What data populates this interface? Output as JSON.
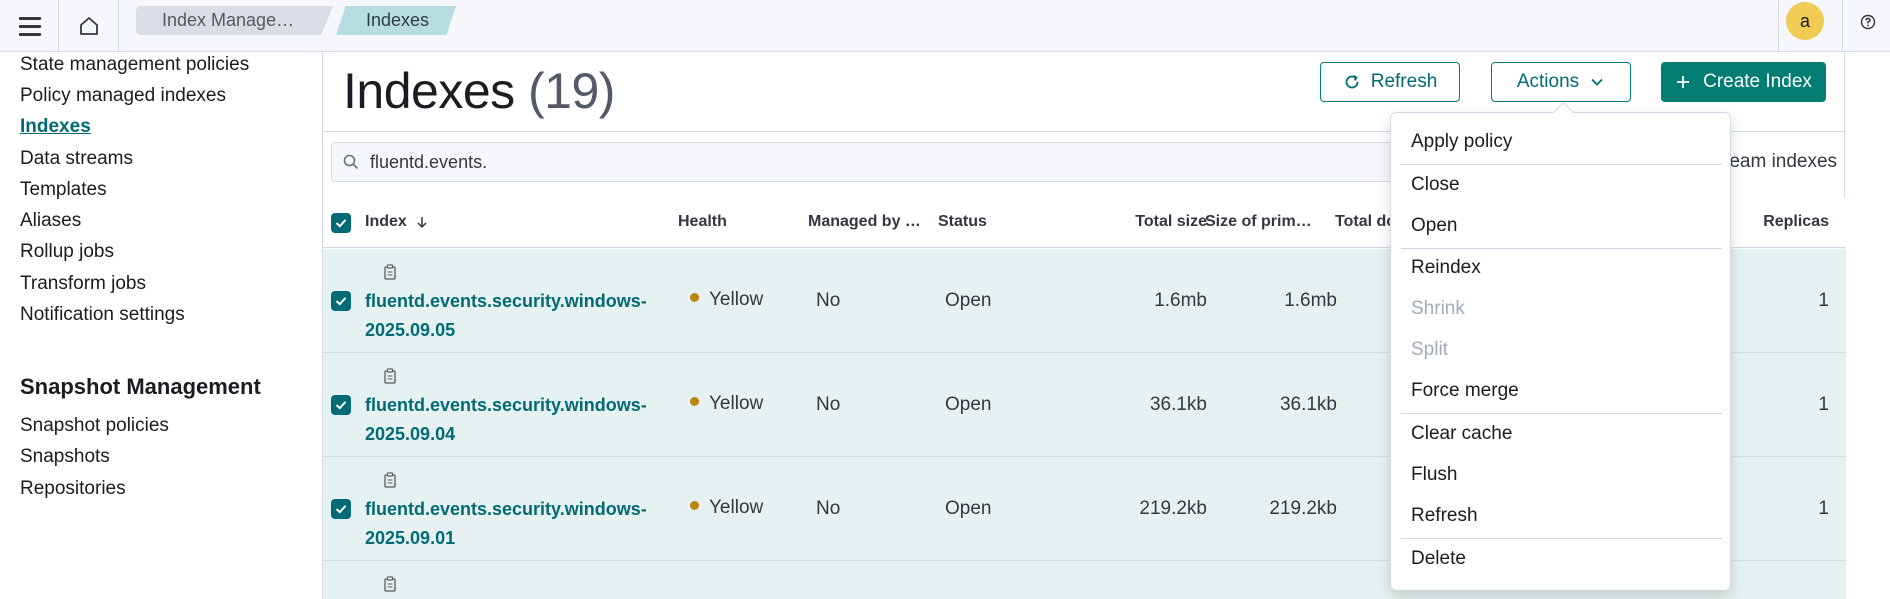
{
  "header": {
    "breadcrumbs": [
      "Index Manage…",
      "Indexes"
    ],
    "avatar_initial": "a"
  },
  "sidebar": {
    "items": [
      {
        "label": "State management policies"
      },
      {
        "label": "Policy managed indexes"
      },
      {
        "label": "Indexes",
        "active": true
      },
      {
        "label": "Data streams"
      },
      {
        "label": "Templates"
      },
      {
        "label": "Aliases"
      },
      {
        "label": "Rollup jobs"
      },
      {
        "label": "Transform jobs"
      },
      {
        "label": "Notification settings"
      }
    ],
    "snapshot_heading": "Snapshot Management",
    "snapshot_items": [
      {
        "label": "Snapshot policies"
      },
      {
        "label": "Snapshots"
      },
      {
        "label": "Repositories"
      }
    ]
  },
  "main": {
    "title": "Indexes",
    "count": "(19)",
    "refresh_label": "Refresh",
    "actions_label": "Actions",
    "create_label": "Create Index",
    "search_value": "fluentd.events.",
    "stream_toggle_label": "ream indexes"
  },
  "table": {
    "columns": {
      "index": "Index",
      "health": "Health",
      "managed": "Managed by …",
      "status": "Status",
      "total_size": "Total size",
      "primary_size": "Size of prim…",
      "total_docs": "Total do",
      "replicas": "Replicas"
    },
    "rows": [
      {
        "name_line1": "fluentd.events.security.windows-",
        "name_line2": "2025.09.05",
        "health": "Yellow",
        "managed": "No",
        "status": "Open",
        "total_size": "1.6mb",
        "primary_size": "1.6mb",
        "replicas": "1"
      },
      {
        "name_line1": "fluentd.events.security.windows-",
        "name_line2": "2025.09.04",
        "health": "Yellow",
        "managed": "No",
        "status": "Open",
        "total_size": "36.1kb",
        "primary_size": "36.1kb",
        "replicas": "1"
      },
      {
        "name_line1": "fluentd.events.security.windows-",
        "name_line2": "2025.09.01",
        "health": "Yellow",
        "managed": "No",
        "status": "Open",
        "total_size": "219.2kb",
        "primary_size": "219.2kb",
        "replicas": "1"
      }
    ]
  },
  "actions_menu": {
    "items": [
      {
        "label": "Apply policy"
      },
      {
        "label": "Close"
      },
      {
        "label": "Open"
      },
      {
        "label": "Reindex"
      },
      {
        "label": "Shrink",
        "disabled": true
      },
      {
        "label": "Split",
        "disabled": true
      },
      {
        "label": "Force merge"
      },
      {
        "label": "Clear cache"
      },
      {
        "label": "Flush"
      },
      {
        "label": "Refresh"
      },
      {
        "label": "Delete"
      }
    ]
  },
  "colors": {
    "accent": "#017d73",
    "link": "#006b75",
    "selected_row": "#e6f2f1",
    "health_yellow": "#b8860b",
    "avatar": "#f0cc55"
  }
}
